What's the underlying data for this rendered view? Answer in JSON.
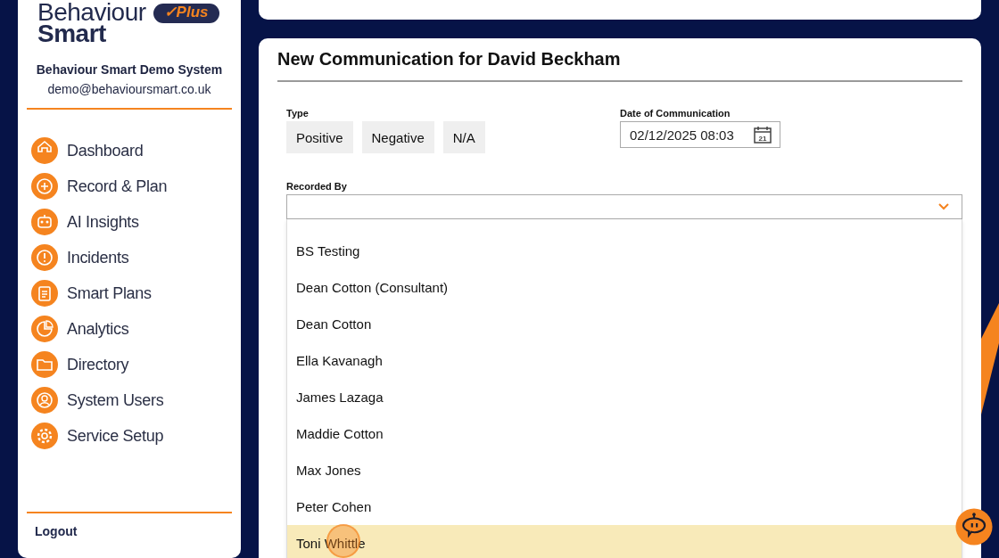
{
  "sidebar": {
    "logo": {
      "line_1": "Behaviour",
      "line_2": "Smart",
      "badge": "✓Plus"
    },
    "organisation": "Behaviour Smart Demo System",
    "email": "demo@behavioursmart.co.uk",
    "items": [
      {
        "label": "Dashboard"
      },
      {
        "label": "Record & Plan"
      },
      {
        "label": "AI Insights"
      },
      {
        "label": "Incidents"
      },
      {
        "label": "Smart Plans"
      },
      {
        "label": "Analytics"
      },
      {
        "label": "Directory"
      },
      {
        "label": "System Users"
      },
      {
        "label": "Service Setup"
      }
    ],
    "logout": "Logout"
  },
  "form": {
    "title": "New Communication for David Beckham",
    "type": {
      "label": "Type",
      "options": [
        "Positive",
        "Negative",
        "N/A"
      ]
    },
    "date": {
      "label": "Date of Communication",
      "value": "02/12/2025 08:03",
      "icon_text": "21"
    },
    "recorded_by": {
      "label": "Recorded By",
      "options": [
        {
          "label": "BS Testing",
          "selected": false
        },
        {
          "label": "Dean Cotton (Consultant)",
          "selected": false
        },
        {
          "label": "Dean Cotton",
          "selected": false
        },
        {
          "label": "Ella Kavanagh",
          "selected": false
        },
        {
          "label": "James Lazaga",
          "selected": false
        },
        {
          "label": "Maddie Cotton",
          "selected": false
        },
        {
          "label": "Max Jones",
          "selected": false
        },
        {
          "label": "Peter Cohen",
          "selected": false
        },
        {
          "label": "Toni Whittle",
          "selected": true
        }
      ]
    }
  }
}
